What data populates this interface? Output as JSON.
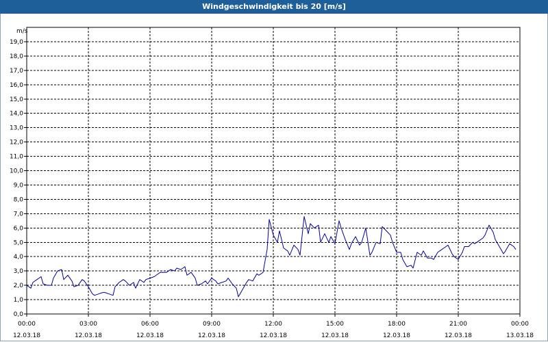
{
  "window": {
    "title": "Windgeschwindigkeit bis 20 [m/s]"
  },
  "chart_data": {
    "type": "line",
    "title": "Windgeschwindigkeit bis 20 [m/s]",
    "xlabel": "",
    "ylabel": "m/s",
    "ylim": [
      0,
      20
    ],
    "y_ticks": [
      "0,0",
      "1,0",
      "2,0",
      "3,0",
      "4,0",
      "5,0",
      "6,0",
      "7,0",
      "8,0",
      "9,0",
      "10,0",
      "11,0",
      "12,0",
      "13,0",
      "14,0",
      "15,0",
      "16,0",
      "17,0",
      "18,0",
      "19,0"
    ],
    "x_ticks": [
      {
        "time": "00:00",
        "date": "12.03.18"
      },
      {
        "time": "03:00",
        "date": "12.03.18"
      },
      {
        "time": "06:00",
        "date": "12.03.18"
      },
      {
        "time": "09:00",
        "date": "12.03.18"
      },
      {
        "time": "12:00",
        "date": "12.03.18"
      },
      {
        "time": "15:00",
        "date": "12.03.18"
      },
      {
        "time": "18:00",
        "date": "12.03.18"
      },
      {
        "time": "21:00",
        "date": "12.03.18"
      },
      {
        "time": "00:00",
        "date": "13.03.18"
      }
    ],
    "grid": true,
    "line_color": "#0000a0",
    "series": [
      {
        "x_hours": [
          0.0,
          0.2,
          0.3,
          0.5,
          0.7,
          0.8,
          1.0,
          1.2,
          1.3,
          1.5,
          1.7,
          1.8,
          2.0,
          2.2,
          2.3,
          2.5,
          2.7,
          2.8,
          3.0,
          3.2,
          3.3,
          3.5,
          3.7,
          3.8,
          4.0,
          4.2,
          4.3,
          4.5,
          4.7,
          4.8,
          5.0,
          5.2,
          5.3,
          5.5,
          5.7,
          5.8,
          6.0,
          6.2,
          6.3,
          6.5,
          6.7,
          6.8,
          7.0,
          7.2,
          7.3,
          7.5,
          7.7,
          7.8,
          8.0,
          8.2,
          8.3,
          8.5,
          8.7,
          8.8,
          9.0,
          9.2,
          9.3,
          9.5,
          9.7,
          9.8,
          10.0,
          10.2,
          10.3,
          10.5,
          10.7,
          10.8,
          11.0,
          11.2,
          11.3,
          11.5,
          11.7,
          11.8,
          12.0,
          12.2,
          12.3,
          12.5,
          12.7,
          12.8,
          13.0,
          13.2,
          13.3,
          13.5,
          13.7,
          13.8,
          14.0,
          14.2,
          14.3,
          14.5,
          14.7,
          14.8,
          15.0,
          15.2,
          15.3,
          15.5,
          15.7,
          15.8,
          16.0,
          16.2,
          16.3,
          16.5,
          16.7,
          16.8,
          17.0,
          17.2,
          17.3,
          17.5,
          17.7,
          17.8,
          18.0,
          18.2,
          18.3,
          18.5,
          18.7,
          18.8,
          19.0,
          19.2,
          19.3,
          19.5,
          19.7,
          19.8,
          20.0,
          20.2,
          20.3,
          20.5,
          20.7,
          20.8,
          21.0,
          21.2,
          21.3,
          21.5,
          21.7,
          21.8,
          22.0,
          22.2,
          22.3,
          22.5,
          22.7,
          22.8,
          23.0,
          23.2,
          23.3,
          23.5,
          23.7,
          23.8
        ],
        "y": [
          2.0,
          1.8,
          2.2,
          2.4,
          2.6,
          2.1,
          2.0,
          2.0,
          2.5,
          3.0,
          3.1,
          2.4,
          2.7,
          2.3,
          1.9,
          2.0,
          2.4,
          2.3,
          1.9,
          1.4,
          1.3,
          1.4,
          1.5,
          1.5,
          1.4,
          1.3,
          1.9,
          2.2,
          2.4,
          2.3,
          2.0,
          2.2,
          1.8,
          2.4,
          2.2,
          2.4,
          2.5,
          2.6,
          2.7,
          2.9,
          2.9,
          2.9,
          3.1,
          3.0,
          3.2,
          3.1,
          3.3,
          2.7,
          2.9,
          2.5,
          2.0,
          2.1,
          2.3,
          2.1,
          2.5,
          2.3,
          2.1,
          2.2,
          2.3,
          2.5,
          2.1,
          1.8,
          1.2,
          1.7,
          2.2,
          2.4,
          2.3,
          2.8,
          2.7,
          2.9,
          4.5,
          6.6,
          5.5,
          5.0,
          5.8,
          4.6,
          4.4,
          4.1,
          4.8,
          4.5,
          4.1,
          6.8,
          5.6,
          6.3,
          6.0,
          6.2,
          5.0,
          5.6,
          5.0,
          5.4,
          4.9,
          6.5,
          6.0,
          5.2,
          4.5,
          4.9,
          5.4,
          4.8,
          5.0,
          6.0,
          4.1,
          4.3,
          5.0,
          4.9,
          6.1,
          5.8,
          5.5,
          5.0,
          4.3,
          4.3,
          3.8,
          3.3,
          3.4,
          3.2,
          4.3,
          4.1,
          4.4,
          3.9,
          3.9,
          3.8,
          4.3,
          4.5,
          4.6,
          4.8,
          4.2,
          4.0,
          3.8,
          4.3,
          4.7,
          4.7,
          5.0,
          4.9,
          5.1,
          5.3,
          5.5,
          6.2,
          5.7,
          5.2,
          4.7,
          4.2,
          4.4,
          4.9,
          4.7,
          4.5
        ]
      }
    ]
  }
}
